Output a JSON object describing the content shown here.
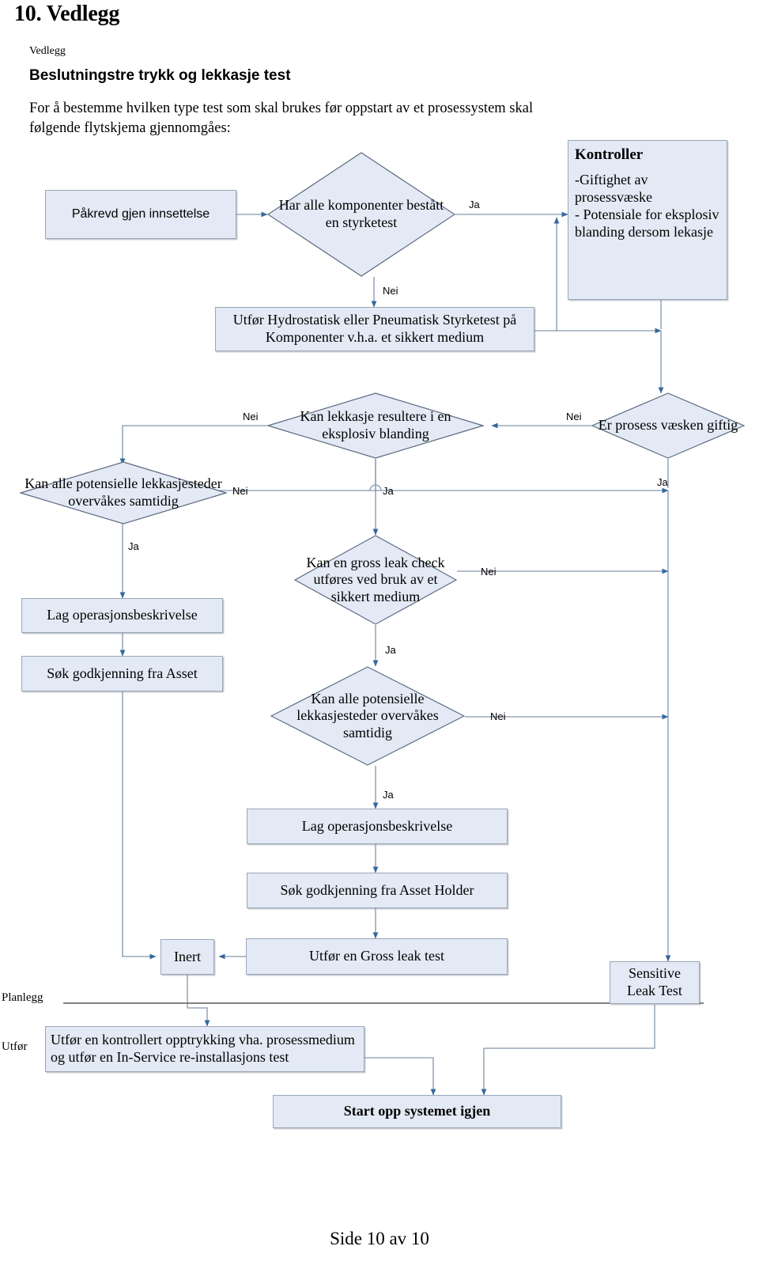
{
  "document": {
    "title": "10. Vedlegg",
    "vedlegg_label": "Vedlegg",
    "subtitle": "Beslutningstre trykk og lekkasje test",
    "intro": "For å bestemme hvilken type test som skal brukes før oppstart av et prosessystem skal følgende flytskjema gjennomgåes:",
    "footer": "Side 10 av 10"
  },
  "flowchart": {
    "nodes": {
      "start": "Påkrevd gjen innsettelse",
      "d_styrketest": "Har alle komponenter bestått en styrketest",
      "kontroller_title": "Kontroller",
      "kontroller_body": "-Giftighet av prosessvæske\n- Potensiale for eksplosiv  blanding dersom lekasje",
      "utfor_styrketest": "Utfør Hydrostatisk eller Pneumatisk Styrketest på Komponenter v.h.a. et sikkert medium",
      "d_eksplosiv": "Kan lekkasje resultere i en eksplosiv blanding",
      "d_giftig": "Er prosess væsken giftig",
      "d_lekkasjesteder_1": "Kan alle potensielle lekkasjesteder overvåkes samtidig",
      "lag_opsbeskrivelse_1": "Lag operasjonsbeskrivelse",
      "sok_godkjenning_asset": "Søk godkjenning fra Asset",
      "d_grossleak": "Kan en gross leak check utføres ved bruk av et sikkert medium",
      "d_lekkasjesteder_2": "Kan alle potensielle lekkasjesteder overvåkes samtidig",
      "lag_opsbeskrivelse_2": "Lag operasjonsbeskrivelse",
      "sok_godkjenning_asset_holder": "Søk godkjenning fra Asset Holder",
      "inert": "Inert",
      "gross_leak_test": "Utfør en Gross leak test",
      "sensitive_leak_test": "Sensitive Leak Test",
      "kontrollert_opptrykking": "Utfør en kontrollert opptrykking vha. prosessmedium og utfør en In-Service re-installasjons test",
      "start_opp": "Start opp systemet igjen"
    },
    "edge_labels": {
      "ja_styrketest": "Ja",
      "nei_styrketest": "Nei",
      "nei_eksplosiv_left": "Nei",
      "ja_eksplosiv": "Ja",
      "nei_giftig": "Nei",
      "ja_giftig": "Ja",
      "nei_lekkasje1": "Nei",
      "ja_lekkasje1": "Ja",
      "nei_grossleak": "Nei",
      "ja_grossleak": "Ja",
      "nei_lekkasje2": "Nei",
      "ja_lekkasje2": "Ja"
    },
    "lanes": {
      "planlegg": "Planlegg",
      "utfor": "Utfør"
    },
    "colors": {
      "node_fill": "#e3eaf5",
      "node_border": "#9aa7b8",
      "diamond_border": "#5c6b80",
      "connector": "#8496ad",
      "arrowhead": "#36689e",
      "lane_divider": "#808080"
    }
  }
}
